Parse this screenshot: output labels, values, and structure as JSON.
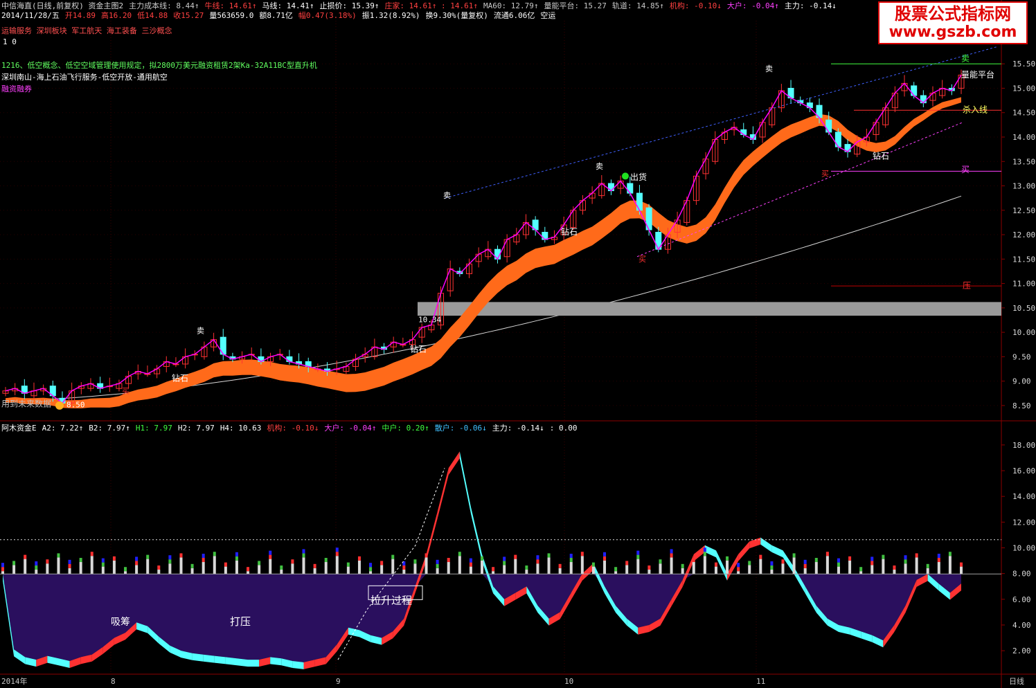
{
  "header": {
    "title_segments": [
      {
        "text": "中信海直(日线,前复权) 资金主图2",
        "color": "#d8d8d8"
      },
      {
        "text": "主力成本线: 8.44↑",
        "color": "#c8c8c8"
      },
      {
        "text": "牛线: 14.61↑",
        "color": "#ff4040"
      },
      {
        "text": "马线: 14.41↑",
        "color": "#ffffff"
      },
      {
        "text": "止损价: 15.39↑",
        "color": "#ffffff"
      },
      {
        "text": "庄家: 14.61↑ : 14.61↑",
        "color": "#ff4040"
      },
      {
        "text": "MA60: 12.79↑",
        "color": "#c8c8c8"
      },
      {
        "text": "量能平台: 15.27",
        "color": "#c8c8c8"
      },
      {
        "text": "轨道: 14.85↑",
        "color": "#c8c8c8"
      },
      {
        "text": "机构: -0.10↓",
        "color": "#ff4040"
      },
      {
        "text": "大户: -0.04↑",
        "color": "#ff40ff"
      },
      {
        "text": "主力: -0.14↓",
        "color": "#ffffff"
      }
    ],
    "info_segments": [
      {
        "text": "2014/11/28/五",
        "color": "#ffffff"
      },
      {
        "text": "开14.89",
        "color": "#ff4040"
      },
      {
        "text": "高16.20",
        "color": "#ff4040"
      },
      {
        "text": "低14.88",
        "color": "#ff4040"
      },
      {
        "text": "收15.27",
        "color": "#ff4040"
      },
      {
        "text": "量563659.0",
        "color": "#ffffff"
      },
      {
        "text": "额8.71亿",
        "color": "#ffffff"
      },
      {
        "text": "幅0.47(3.18%)",
        "color": "#ff4040"
      },
      {
        "text": "振1.32(8.92%)",
        "color": "#ffffff"
      },
      {
        "text": "换9.30%(量复权)",
        "color": "#ffffff"
      },
      {
        "text": "流通6.06亿",
        "color": "#ffffff"
      },
      {
        "text": "空运",
        "color": "#ffffff"
      }
    ],
    "concepts": "运输服务 深圳板块 军工航天 海工装备 三沙概念",
    "counter": "1 0",
    "news1": "1216、低空概念、低空空域管理使用规定，拟2800万美元融资租赁2架Ka-32A11BC型直升机",
    "news2": "深圳南山-海上石油飞行服务-低空开放-通用航空",
    "news3": "融资融券"
  },
  "watermark": {
    "line1": "股票公式指标网",
    "line2": "www.gszb.com"
  },
  "indicator_header": [
    {
      "text": "阿木资金E",
      "color": "#ffffff"
    },
    {
      "text": "A2: 7.22↑",
      "color": "#ffffff"
    },
    {
      "text": "B2: 7.97↑",
      "color": "#ffffff"
    },
    {
      "text": "H1: 7.97",
      "color": "#40ff40"
    },
    {
      "text": "H2: 7.97",
      "color": "#ffffff"
    },
    {
      "text": "H4: 10.63",
      "color": "#ffffff"
    },
    {
      "text": "机构: -0.10↓",
      "color": "#ff4040"
    },
    {
      "text": "大户: -0.04↑",
      "color": "#ff40ff"
    },
    {
      "text": "中户: 0.20↑",
      "color": "#40ff40"
    },
    {
      "text": "散户: -0.06↓",
      "color": "#40c0ff"
    },
    {
      "text": "主力: -0.14↓",
      "color": "#ffffff"
    },
    {
      "text": ": 0.00",
      "color": "#ffffff"
    }
  ],
  "annotations": {
    "sell": "卖",
    "buy": "买",
    "diamond": "钻石",
    "ship": "出货",
    "volume_platform": "量能平台",
    "kill_line": "杀入线",
    "pressure": "压",
    "future_data": "用到未来数据",
    "low_price": "8.50",
    "gap_price": "10.34",
    "accumulate": "吸筹",
    "suppress": "打压",
    "rally": "拉升过程"
  },
  "x_axis": {
    "labels": [
      "2014年",
      "8",
      "9",
      "10",
      "11"
    ],
    "period": "日线"
  },
  "colors": {
    "background": "#000000",
    "up": "#ff3232",
    "down": "#54ffff",
    "band": "#ff6a1a",
    "grid": "#8b0000",
    "funds_area": "#2a0f5e",
    "ma": "#d7d7d7",
    "price_line": "#ff00ff"
  },
  "chart_data": [
    {
      "type": "candlestick",
      "title": "中信海直(日线,前复权) 资金主图2",
      "y_axis_ticks": [
        8.5,
        9.0,
        9.5,
        10.0,
        10.5,
        11.0,
        11.5,
        12.0,
        12.5,
        13.0,
        13.5,
        14.0,
        14.5,
        15.0,
        15.5
      ],
      "ylim": [
        8.3,
        15.9
      ],
      "last_bar": {
        "date": "2014/11/28",
        "open": 14.89,
        "high": 16.2,
        "low": 14.88,
        "close": 15.27
      },
      "close": [
        8.8,
        8.85,
        8.75,
        8.8,
        8.85,
        8.7,
        8.55,
        8.8,
        8.9,
        8.95,
        8.85,
        8.9,
        8.95,
        9.1,
        9.2,
        9.15,
        9.25,
        9.4,
        9.35,
        9.5,
        9.55,
        9.7,
        9.85,
        9.55,
        9.45,
        9.5,
        9.55,
        9.4,
        9.5,
        9.55,
        9.4,
        9.35,
        9.3,
        9.25,
        9.2,
        9.25,
        9.3,
        9.45,
        9.55,
        9.7,
        9.65,
        9.8,
        9.75,
        9.85,
        10.1,
        10.15,
        10.8,
        11.3,
        11.2,
        11.4,
        11.6,
        11.7,
        11.5,
        11.9,
        12.0,
        12.25,
        12.1,
        11.9,
        11.95,
        12.2,
        12.5,
        12.7,
        12.85,
        13.05,
        12.9,
        13.1,
        12.85,
        12.5,
        12.1,
        11.7,
        12.0,
        12.3,
        12.7,
        13.2,
        13.55,
        13.95,
        14.1,
        14.2,
        14.05,
        13.95,
        14.3,
        14.6,
        14.95,
        14.8,
        14.7,
        14.6,
        14.4,
        14.1,
        13.8,
        13.7,
        13.9,
        14.0,
        14.3,
        14.6,
        14.9,
        15.1,
        14.85,
        14.7,
        14.9,
        15.0,
        14.95,
        15.27
      ],
      "ma60_range": [
        8.6,
        12.79
      ],
      "series": [
        {
          "name": "牛线",
          "last": 14.61
        },
        {
          "name": "马线",
          "last": 14.41
        },
        {
          "name": "主力成本线",
          "last": 8.44
        },
        {
          "name": "MA60",
          "last": 12.79
        }
      ]
    },
    {
      "type": "bar",
      "title": "阿木资金E",
      "y_axis_ticks": [
        2.0,
        4.0,
        6.0,
        8.0,
        10.0,
        12.0,
        14.0,
        16.0,
        18.0
      ],
      "ylim": [
        0.5,
        18.8
      ],
      "baseline": 7.97,
      "funds_line": [
        7.97,
        2.1,
        1.5,
        1.3,
        1.6,
        1.4,
        1.2,
        1.5,
        1.7,
        2.3,
        3.0,
        3.4,
        4.2,
        3.9,
        3.1,
        2.4,
        2.0,
        1.8,
        1.7,
        1.6,
        1.5,
        1.4,
        1.3,
        1.3,
        1.5,
        1.4,
        1.2,
        1.1,
        1.3,
        1.5,
        2.5,
        3.8,
        3.6,
        3.2,
        3.0,
        3.5,
        4.5,
        7.0,
        9.5,
        12.8,
        16.2,
        17.5,
        13.2,
        9.5,
        7.0,
        6.0,
        6.5,
        7.0,
        5.5,
        4.5,
        5.0,
        6.5,
        8.0,
        8.8,
        7.0,
        5.5,
        4.5,
        3.8,
        4.0,
        4.5,
        6.0,
        7.5,
        9.5,
        10.2,
        9.8,
        8.0,
        9.5,
        10.5,
        10.8,
        10.2,
        9.8,
        8.5,
        7.0,
        5.5,
        4.5,
        4.0,
        3.8,
        3.5,
        3.2,
        2.8,
        4.0,
        5.5,
        7.5,
        7.97,
        7.2,
        6.5,
        7.22
      ],
      "reference_level": 10.63
    }
  ]
}
